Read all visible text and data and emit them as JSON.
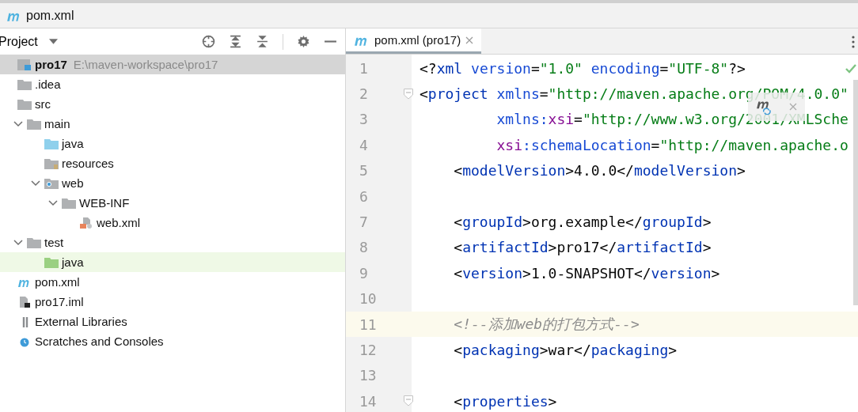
{
  "breadcrumb": {
    "label": "pom.xml"
  },
  "project_panel": {
    "title": "Project",
    "tree": [
      {
        "label": "pro17",
        "path": "E:\\maven-workspace\\pro17",
        "kind": "module",
        "bold": true,
        "selected": true,
        "tinted": false,
        "children": [
          {
            "label": ".idea",
            "kind": "folder",
            "bold": false,
            "selected": false,
            "tinted": false
          },
          {
            "label": "src",
            "kind": "folder",
            "bold": false,
            "selected": false,
            "tinted": false,
            "children": [
              {
                "label": "main",
                "kind": "folder",
                "expanded": true,
                "bold": false,
                "selected": false,
                "tinted": false,
                "children": [
                  {
                    "label": "java",
                    "kind": "source-folder",
                    "bold": false,
                    "selected": false,
                    "tinted": false
                  },
                  {
                    "label": "resources",
                    "kind": "resources-folder",
                    "bold": false,
                    "selected": false,
                    "tinted": false
                  },
                  {
                    "label": "web",
                    "kind": "web-folder",
                    "expanded": true,
                    "bold": false,
                    "selected": false,
                    "tinted": false,
                    "children": [
                      {
                        "label": "WEB-INF",
                        "kind": "folder",
                        "expanded": true,
                        "bold": false,
                        "selected": false,
                        "tinted": false,
                        "children": [
                          {
                            "label": "web.xml",
                            "kind": "web-xml-file",
                            "bold": false,
                            "selected": false,
                            "tinted": false
                          }
                        ]
                      }
                    ]
                  }
                ]
              },
              {
                "label": "test",
                "kind": "folder",
                "expanded": true,
                "bold": false,
                "selected": false,
                "tinted": false,
                "children": [
                  {
                    "label": "java",
                    "kind": "test-folder",
                    "bold": false,
                    "selected": false,
                    "tinted": true
                  }
                ]
              }
            ]
          },
          {
            "label": "pom.xml",
            "kind": "maven-file",
            "bold": false,
            "selected": false,
            "tinted": false
          },
          {
            "label": "pro17.iml",
            "kind": "iml-file",
            "bold": false,
            "selected": false,
            "tinted": false
          }
        ]
      },
      {
        "label": "External Libraries",
        "kind": "libraries",
        "bold": false,
        "selected": false,
        "tinted": false
      },
      {
        "label": "Scratches and Consoles",
        "kind": "scratches",
        "bold": false,
        "selected": false,
        "tinted": false
      }
    ]
  },
  "editor": {
    "tabs": [
      {
        "label": "pom.xml (pro17)",
        "selected": true
      }
    ],
    "lines": [
      {
        "number": "1",
        "current": false,
        "fold": false,
        "tokens": [
          {
            "text": "<?",
            "kind": "punct"
          },
          {
            "text": "xml",
            "kind": "tag"
          },
          {
            "text": " version",
            "kind": "attr"
          },
          {
            "text": "=",
            "kind": "punct"
          },
          {
            "text": "\"1.0\"",
            "kind": "value"
          },
          {
            "text": " encoding",
            "kind": "attr"
          },
          {
            "text": "=",
            "kind": "punct"
          },
          {
            "text": "\"UTF-8\"",
            "kind": "value"
          },
          {
            "text": "?>",
            "kind": "punct"
          }
        ]
      },
      {
        "number": "2",
        "current": false,
        "fold": true,
        "tokens": [
          {
            "text": "<",
            "kind": "punct"
          },
          {
            "text": "project",
            "kind": "tag"
          },
          {
            "text": " xmlns",
            "kind": "attr"
          },
          {
            "text": "=",
            "kind": "punct"
          },
          {
            "text": "\"http://maven.apache.org/POM/4.0.0\"",
            "kind": "value"
          }
        ]
      },
      {
        "number": "3",
        "current": false,
        "fold": false,
        "tokens": [
          {
            "text": "         xmlns:",
            "kind": "attr"
          },
          {
            "text": "xsi",
            "kind": "namespace"
          },
          {
            "text": "=",
            "kind": "punct"
          },
          {
            "text": "\"http://www.w3.org/2001/XMLSche",
            "kind": "value"
          }
        ]
      },
      {
        "number": "4",
        "current": false,
        "fold": false,
        "tokens": [
          {
            "text": "         xsi",
            "kind": "namespace"
          },
          {
            "text": ":schemaLocation",
            "kind": "attr"
          },
          {
            "text": "=",
            "kind": "punct"
          },
          {
            "text": "\"http://maven.apache.o",
            "kind": "value"
          }
        ]
      },
      {
        "number": "5",
        "current": false,
        "fold": false,
        "tokens": [
          {
            "text": "    <",
            "kind": "punct"
          },
          {
            "text": "modelVersion",
            "kind": "tag"
          },
          {
            "text": ">4.0.0</",
            "kind": "punct"
          },
          {
            "text": "modelVersion",
            "kind": "tag"
          },
          {
            "text": ">",
            "kind": "punct"
          }
        ]
      },
      {
        "number": "6",
        "current": false,
        "fold": false
      },
      {
        "number": "7",
        "current": false,
        "fold": false,
        "tokens": [
          {
            "text": "    <",
            "kind": "punct"
          },
          {
            "text": "groupId",
            "kind": "tag"
          },
          {
            "text": ">org.example</",
            "kind": "punct"
          },
          {
            "text": "groupId",
            "kind": "tag"
          },
          {
            "text": ">",
            "kind": "punct"
          }
        ]
      },
      {
        "number": "8",
        "current": false,
        "fold": false,
        "tokens": [
          {
            "text": "    <",
            "kind": "punct"
          },
          {
            "text": "artifactId",
            "kind": "tag"
          },
          {
            "text": ">pro17</",
            "kind": "punct"
          },
          {
            "text": "artifactId",
            "kind": "tag"
          },
          {
            "text": ">",
            "kind": "punct"
          }
        ]
      },
      {
        "number": "9",
        "current": false,
        "fold": false,
        "tokens": [
          {
            "text": "    <",
            "kind": "punct"
          },
          {
            "text": "version",
            "kind": "tag"
          },
          {
            "text": ">1.0-SNAPSHOT</",
            "kind": "punct"
          },
          {
            "text": "version",
            "kind": "tag"
          },
          {
            "text": ">",
            "kind": "punct"
          }
        ]
      },
      {
        "number": "10",
        "current": false,
        "fold": false
      },
      {
        "number": "11",
        "current": true,
        "fold": false,
        "tokens": [
          {
            "text": "    <!--添加web的打包方式-->",
            "kind": "comment"
          }
        ]
      },
      {
        "number": "12",
        "current": false,
        "fold": false,
        "tokens": [
          {
            "text": "    <",
            "kind": "punct"
          },
          {
            "text": "packaging",
            "kind": "tag"
          },
          {
            "text": ">war</",
            "kind": "punct"
          },
          {
            "text": "packaging",
            "kind": "tag"
          },
          {
            "text": ">",
            "kind": "punct"
          }
        ]
      },
      {
        "number": "13",
        "current": false,
        "fold": false
      },
      {
        "number": "14",
        "current": false,
        "fold": true,
        "tokens": [
          {
            "text": "    <",
            "kind": "punct"
          },
          {
            "text": "properties",
            "kind": "tag"
          },
          {
            "text": ">",
            "kind": "punct"
          }
        ]
      }
    ]
  }
}
